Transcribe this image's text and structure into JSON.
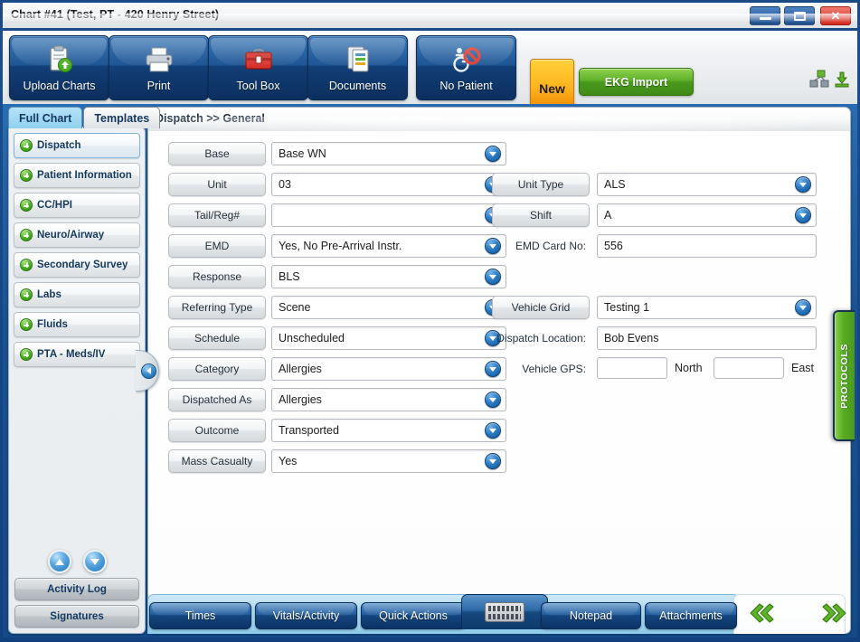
{
  "window": {
    "title": "Chart #41 (Test, PT - 420 Henry Street)",
    "minimize_label": "",
    "maximize_label": "",
    "close_label": "✕"
  },
  "toolbar": {
    "buttons": [
      {
        "id": "upload-charts",
        "label": "Upload Charts",
        "icon": "clipboard-upload-icon"
      },
      {
        "id": "print",
        "label": "Print",
        "icon": "printer-icon"
      },
      {
        "id": "tool-box",
        "label": "Tool Box",
        "icon": "toolbox-icon"
      },
      {
        "id": "documents",
        "label": "Documents",
        "icon": "documents-icon"
      },
      {
        "id": "no-patient",
        "label": "No Patient",
        "icon": "no-patient-icon"
      }
    ],
    "new_label": "New",
    "ekg_import_label": "EKG Import",
    "patient_select_value": "Test, PT",
    "sync_icon": "network-nodes-icon",
    "download_icon": "download-icon"
  },
  "tabs": [
    {
      "id": "full-chart",
      "label": "Full Chart",
      "active": true
    },
    {
      "id": "templates",
      "label": "Templates",
      "active": false
    }
  ],
  "sidebar": {
    "items": [
      {
        "label": "Dispatch",
        "selected": true
      },
      {
        "label": "Patient Information",
        "selected": false
      },
      {
        "label": "CC/HPI",
        "selected": false
      },
      {
        "label": "Neuro/Airway",
        "selected": false
      },
      {
        "label": "Secondary Survey",
        "selected": false
      },
      {
        "label": "Labs",
        "selected": false
      },
      {
        "label": "Fluids",
        "selected": false
      },
      {
        "label": "PTA - Meds/IV",
        "selected": false
      }
    ],
    "scroll_up_icon": "arrow-up-icon",
    "scroll_down_icon": "arrow-down-icon",
    "activity_log_label": "Activity Log",
    "signatures_label": "Signatures"
  },
  "content": {
    "breadcrumb": "Dispatch >> General",
    "left_fields": [
      {
        "label": "Base",
        "value": "Base WN",
        "type": "combo"
      },
      {
        "label": "Unit",
        "value": "03",
        "type": "combo"
      },
      {
        "label": "Tail/Reg#",
        "value": "",
        "type": "combo"
      },
      {
        "label": "EMD",
        "value": "Yes, No Pre-Arrival Instr.",
        "type": "combo"
      },
      {
        "label": "Response",
        "value": "BLS",
        "type": "combo"
      },
      {
        "label": "Referring Type",
        "value": "Scene",
        "type": "combo"
      },
      {
        "label": "Schedule",
        "value": "Unscheduled",
        "type": "combo"
      },
      {
        "label": "Category",
        "value": "Allergies",
        "type": "combo"
      },
      {
        "label": "Dispatched As",
        "value": "Allergies",
        "type": "combo"
      },
      {
        "label": "Outcome",
        "value": "Transported",
        "type": "combo"
      },
      {
        "label": "Mass Casualty",
        "value": "Yes",
        "type": "combo"
      }
    ],
    "right_fields": [
      {
        "label": "Unit Type",
        "value": "ALS",
        "type": "combo",
        "label_style": "button"
      },
      {
        "label": "Shift",
        "value": "A",
        "type": "combo",
        "label_style": "button"
      },
      {
        "label": "EMD Card No:",
        "value": "556",
        "type": "text",
        "label_style": "text"
      },
      {
        "label": "Vehicle Grid",
        "value": "Testing 1",
        "type": "combo",
        "label_style": "button"
      },
      {
        "label": "Dispatch Location:",
        "value": "Bob Evens",
        "type": "text",
        "label_style": "text"
      }
    ],
    "vehicle_gps": {
      "label": "Vehicle GPS:",
      "north_value": "",
      "north_label": "North",
      "east_value": "",
      "east_label": "East"
    },
    "protocols_label": "PROTOCOLS",
    "collapse_icon": "chevron-left-icon"
  },
  "bottom_bar": {
    "buttons": [
      {
        "id": "times",
        "label": "Times"
      },
      {
        "id": "vitals-activity",
        "label": "Vitals/Activity"
      },
      {
        "id": "quick-actions",
        "label": "Quick Actions"
      },
      {
        "id": "notepad",
        "label": "Notepad"
      },
      {
        "id": "attachments",
        "label": "Attachments"
      }
    ],
    "keyboard_icon": "keyboard-icon",
    "prev_icon": "double-chevron-left-icon",
    "next_icon": "double-chevron-right-icon"
  },
  "colors": {
    "frame_blue": "#1b4b86",
    "accent_green": "#58ab24",
    "accent_orange": "#ffb21c",
    "tab_active": "#8fd1f0"
  }
}
